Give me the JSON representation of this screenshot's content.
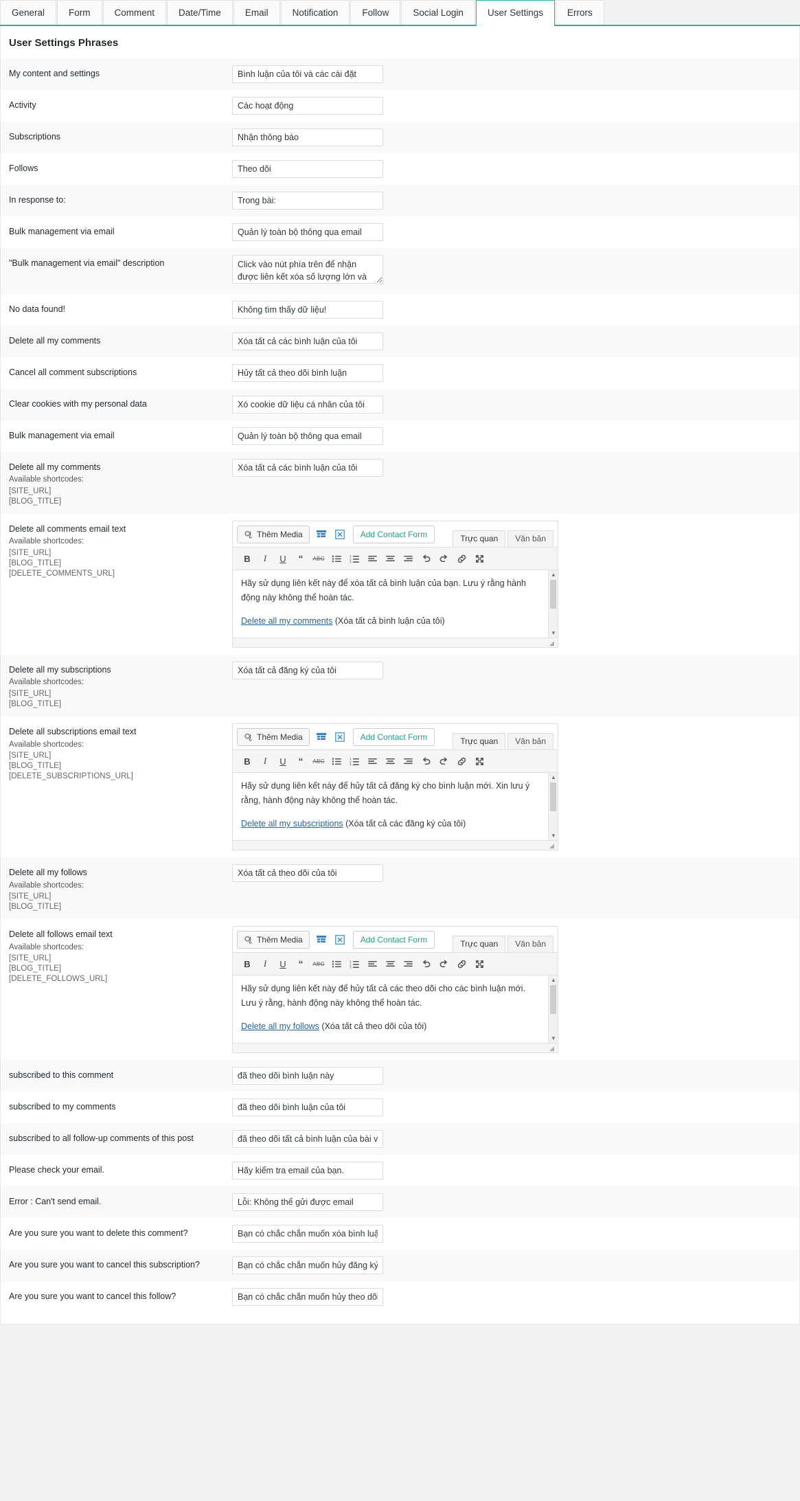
{
  "tabs": [
    {
      "label": "General",
      "active": false
    },
    {
      "label": "Form",
      "active": false
    },
    {
      "label": "Comment",
      "active": false
    },
    {
      "label": "Date/Time",
      "active": false
    },
    {
      "label": "Email",
      "active": false
    },
    {
      "label": "Notification",
      "active": false
    },
    {
      "label": "Follow",
      "active": false
    },
    {
      "label": "Social Login",
      "active": false
    },
    {
      "label": "User Settings",
      "active": true
    },
    {
      "label": "Errors",
      "active": false
    }
  ],
  "panel": {
    "title": "User Settings Phrases",
    "accent": "#24b599"
  },
  "editor_chrome": {
    "add_media": "Thêm Media",
    "add_contact_form": "Add Contact Form",
    "visual_tab": "Trực quan",
    "text_tab": "Văn bản",
    "shortcodes_head": "Available shortcodes:"
  },
  "rows": [
    {
      "type": "input",
      "label": "My content and settings",
      "value": "Bình luận của tôi và các cài đặt"
    },
    {
      "type": "input",
      "label": "Activity",
      "value": "Các hoạt động"
    },
    {
      "type": "input",
      "label": "Subscriptions",
      "value": "Nhận thông báo"
    },
    {
      "type": "input",
      "label": "Follows",
      "value": "Theo dõi"
    },
    {
      "type": "input",
      "label": "In response to:",
      "value": "Trong bài:"
    },
    {
      "type": "input",
      "label": "Bulk management via email",
      "value": "Quản lý toàn bộ thông qua email"
    },
    {
      "type": "textarea",
      "label": "\"Bulk management via email\" description",
      "value": "Click vào nút phía trên để nhận được liên kết xóa số lượng lớn và bỏ theo dõi"
    },
    {
      "type": "input",
      "label": "No data found!",
      "value": "Không tìm thấy dữ liệu!"
    },
    {
      "type": "input",
      "label": "Delete all my comments",
      "value": "Xóa tất cả các bình luận của tôi"
    },
    {
      "type": "input",
      "label": "Cancel all comment subscriptions",
      "value": "Hủy tất cả theo dõi bình luận"
    },
    {
      "type": "input",
      "label": "Clear cookies with my personal data",
      "value": "Xó cookie dữ liệu cá nhân của tôi"
    },
    {
      "type": "input",
      "label": "Bulk management via email",
      "value": "Quản lý toàn bộ thông qua email"
    },
    {
      "type": "input",
      "label": "Delete all my comments",
      "shortcodes": [
        "[SITE_URL]",
        "[BLOG_TITLE]"
      ],
      "value": "Xóa tất cả các bình luận của tôi"
    },
    {
      "type": "editor",
      "label": "Delete all comments email text",
      "shortcodes": [
        "[SITE_URL]",
        "[BLOG_TITLE]",
        "[DELETE_COMMENTS_URL]"
      ],
      "body_p1": "Hãy sử dụng liên kết này để xóa tất cả bình luận của bạn. Lưu ý rằng hành động này không thể hoàn tác.",
      "body_link": "Delete all my comments",
      "body_tail": " (Xóa tất cả bình luận của tôi)"
    },
    {
      "type": "input",
      "label": "Delete all my subscriptions",
      "shortcodes": [
        "[SITE_URL]",
        "[BLOG_TITLE]"
      ],
      "value": "Xóa tất cả đăng ký của tôi"
    },
    {
      "type": "editor",
      "label": "Delete all subscriptions email text",
      "shortcodes": [
        "[SITE_URL]",
        "[BLOG_TITLE]",
        "[DELETE_SUBSCRIPTIONS_URL]"
      ],
      "body_p1": "Hãy sử dụng liên kết này để hủy tất cả đăng ký cho bình luận mới. Xin lưu ý rằng, hành động này không thể hoàn tác.",
      "body_link": "Delete all my subscriptions",
      "body_tail": " (Xóa tất cả các đăng ký của tôi)"
    },
    {
      "type": "input",
      "label": "Delete all my follows",
      "shortcodes": [
        "[SITE_URL]",
        "[BLOG_TITLE]"
      ],
      "value": "Xóa tất cả theo dõi của tôi"
    },
    {
      "type": "editor",
      "label": "Delete all follows email text",
      "shortcodes": [
        "[SITE_URL]",
        "[BLOG_TITLE]",
        "[DELETE_FOLLOWS_URL]"
      ],
      "body_p1": "Hãy sử dụng liên kết này để hủy tất cả các theo dõi cho các bình luận mới. Lưu ý rằng, hành động này không thể hoàn tác.",
      "body_link": "Delete all my follows",
      "body_tail": " (Xóa tất cả theo dõi của tôi)"
    },
    {
      "type": "input",
      "label": "subscribed to this comment",
      "value": "đã theo dõi bình luận này"
    },
    {
      "type": "input",
      "label": "subscribed to my comments",
      "value": "đã theo dõi bình luận của tôi"
    },
    {
      "type": "input",
      "label": "subscribed to all follow-up comments of this post",
      "value": "đã theo dõi tất cả bình luận của bài viết này"
    },
    {
      "type": "input",
      "label": "Please check your email.",
      "value": "Hãy kiểm tra email của bạn."
    },
    {
      "type": "input",
      "label": "Error : Can't send email.",
      "value": "Lỗi: Không thể gửi được email"
    },
    {
      "type": "input",
      "label": "Are you sure you want to delete this comment?",
      "value": "Bạn có chắc chắn muốn xóa bình luận này khô"
    },
    {
      "type": "input",
      "label": "Are you sure you want to cancel this subscription?",
      "value": "Bạn có chắc chắn muốn hủy đăng ký này khôn"
    },
    {
      "type": "input",
      "label": "Are you sure you want to cancel this follow?",
      "value": "Bạn có chắc chắn muốn hủy theo dõi này khôn"
    }
  ]
}
